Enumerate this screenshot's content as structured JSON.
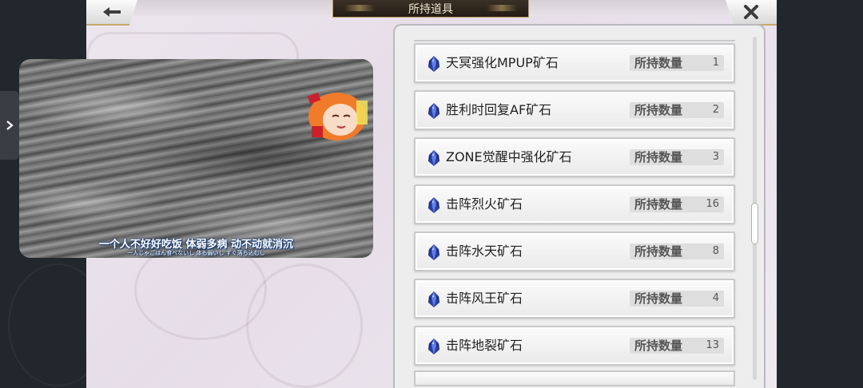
{
  "header": {
    "title": "所持道具",
    "back_icon": "back-arrow-icon",
    "close_icon": "close-x-icon"
  },
  "side_tab": {
    "icon": "chevron-right-icon"
  },
  "video": {
    "subtitle_cn": "一个人不好好吃饭  体弱多病  动不动就消沉",
    "subtitle_jp": "一人じゃごはん食べないし   体も弱いし   すぐ落ち込むし"
  },
  "items": [
    {
      "name": "天冥强化MPUP矿石",
      "qty_label": "所持数量",
      "qty": "1"
    },
    {
      "name": "胜利时回复AF矿石",
      "qty_label": "所持数量",
      "qty": "2"
    },
    {
      "name": "ZONE觉醒中强化矿石",
      "qty_label": "所持数量",
      "qty": "3"
    },
    {
      "name": "击阵烈火矿石",
      "qty_label": "所持数量",
      "qty": "16"
    },
    {
      "name": "击阵水天矿石",
      "qty_label": "所持数量",
      "qty": "8"
    },
    {
      "name": "击阵风王矿石",
      "qty_label": "所持数量",
      "qty": "4"
    },
    {
      "name": "击阵地裂矿石",
      "qty_label": "所持数量",
      "qty": "13"
    }
  ],
  "item_icon": "blue-ore-crystal-icon",
  "scroll_fraction": 0.55
}
